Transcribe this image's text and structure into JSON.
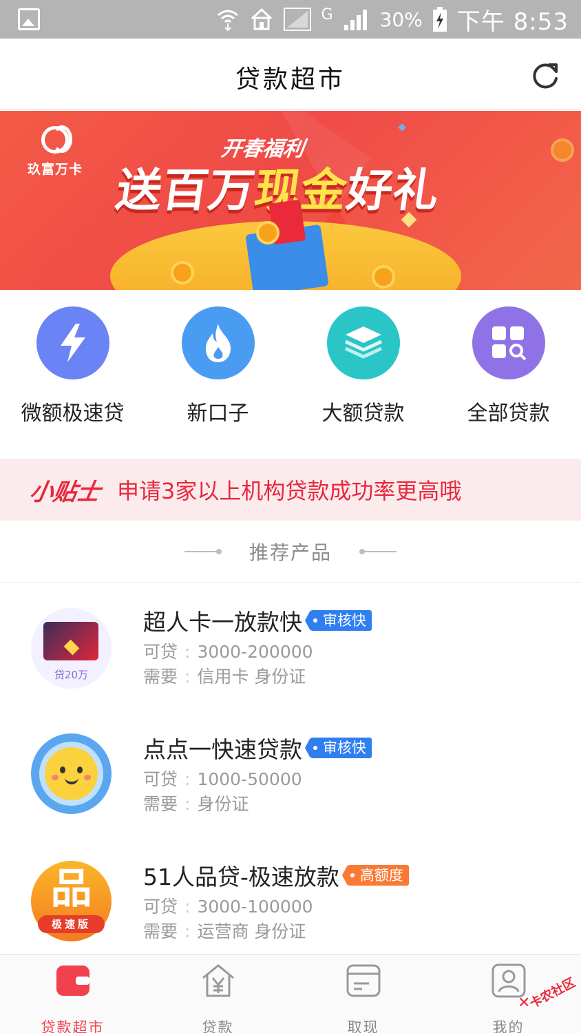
{
  "status_bar": {
    "battery": "30%",
    "time": "下午 8:53",
    "network_type": "G",
    "icons": [
      "image-icon",
      "wifi-icon",
      "home-icon",
      "signal-icon",
      "signal-icon",
      "battery-charging-icon"
    ]
  },
  "header": {
    "title": "贷款超市",
    "refresh_icon": "refresh-icon"
  },
  "banner": {
    "brand": "玖富万卡",
    "subtitle": "开春福利",
    "headline_prefix": "送百万",
    "headline_highlight": "现金",
    "headline_suffix": "好礼"
  },
  "quick_entries": [
    {
      "label": "微额极速贷",
      "icon": "lightning-icon",
      "color": "#6a83f5"
    },
    {
      "label": "新口子",
      "icon": "flame-icon",
      "color": "#4a9cf3"
    },
    {
      "label": "大额贷款",
      "icon": "layers-icon",
      "color": "#2ac5c6"
    },
    {
      "label": "全部贷款",
      "icon": "grid-search-icon",
      "color": "#8f73e6"
    }
  ],
  "tip": {
    "title": "小贴士",
    "text": "申请3家以上机构贷款成功率更高哦"
  },
  "section": {
    "title": "推荐产品"
  },
  "products": [
    {
      "name": "超人卡一放款快",
      "tag": "审核快",
      "tag_color": "#2f7ff0",
      "amount_label": "可贷",
      "amount": "3000-200000",
      "require_label": "需要",
      "require": "信用卡 身份证",
      "logo_caption": "贷20万"
    },
    {
      "name": "点点一快速贷款",
      "tag": "审核快",
      "tag_color": "#2f7ff0",
      "amount_label": "可贷",
      "amount": "1000-50000",
      "require_label": "需要",
      "require": "身份证"
    },
    {
      "name": "51人品贷-极速放款",
      "tag": "高额度",
      "tag_color": "#f97a35",
      "amount_label": "可贷",
      "amount": "3000-100000",
      "require_label": "需要",
      "require": "运营商 身份证",
      "logo_main": "品",
      "logo_caption": "极速版"
    }
  ],
  "bottom_nav": [
    {
      "label": "贷款超市",
      "icon": "wallet-icon",
      "active": true
    },
    {
      "label": "贷款",
      "icon": "yen-house-icon",
      "active": false
    },
    {
      "label": "取现",
      "icon": "card-icon",
      "active": false
    },
    {
      "label": "我的",
      "icon": "person-icon",
      "active": false
    }
  ],
  "watermark": "卡农社区",
  "colors": {
    "accent": "#f0414d",
    "tip_bg": "#fcebed",
    "banner_red": "#ef3f3b"
  }
}
